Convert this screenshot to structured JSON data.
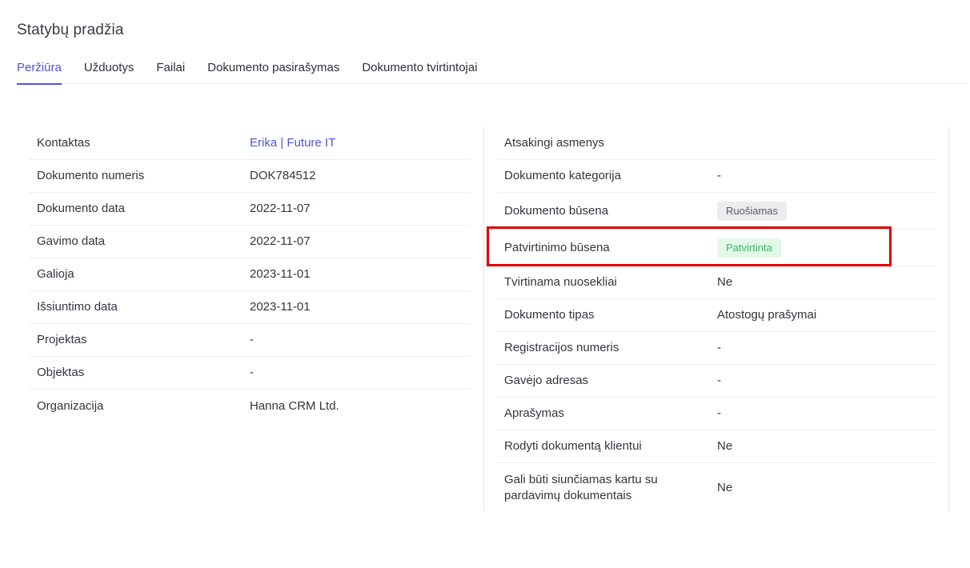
{
  "page": {
    "title": "Statybų pradžia"
  },
  "tabs": [
    {
      "label": "Peržiūra",
      "active": true
    },
    {
      "label": "Užduotys"
    },
    {
      "label": "Failai"
    },
    {
      "label": "Dokumento pasirašymas"
    },
    {
      "label": "Dokumento tvirtintojai"
    }
  ],
  "left": {
    "rows": [
      {
        "label": "Kontaktas",
        "value": "Erika | Future IT"
      },
      {
        "label": "Dokumento numeris",
        "value": "DOK784512"
      },
      {
        "label": "Dokumento data",
        "value": "2022-11-07"
      },
      {
        "label": "Gavimo data",
        "value": "2022-11-07"
      },
      {
        "label": "Galioja",
        "value": "2023-11-01"
      },
      {
        "label": "Išsiuntimo data",
        "value": "2023-11-01"
      },
      {
        "label": "Projektas",
        "value": "-"
      },
      {
        "label": "Objektas",
        "value": "-"
      },
      {
        "label": "Organizacija",
        "value": "Hanna CRM Ltd."
      }
    ]
  },
  "right": {
    "rows": [
      {
        "label": "Atsakingi asmenys",
        "value": ""
      },
      {
        "label": "Dokumento kategorija",
        "value": "-"
      },
      {
        "label": "Dokumento būsena",
        "value": "Ruošiamas"
      },
      {
        "label": "Patvirtinimo būsena",
        "value": "Patvirtinta"
      },
      {
        "label": "Tvirtinama nuosekliai",
        "value": "Ne"
      },
      {
        "label": "Dokumento tipas",
        "value": "Atostogų prašymai"
      },
      {
        "label": "Registracijos numeris",
        "value": "-"
      },
      {
        "label": "Gavėjo adresas",
        "value": "-"
      },
      {
        "label": "Aprašymas",
        "value": "-"
      },
      {
        "label": "Rodyti dokumentą klientui",
        "value": "Ne"
      },
      {
        "label": "Gali būti siunčiamas kartu su pardavimų dokumentais",
        "value": "Ne"
      }
    ]
  },
  "colors": {
    "accent": "#4b55d8",
    "status_grey_bg": "#ececef",
    "status_green_bg": "#e4f8ea",
    "status_green_text": "#3bb865",
    "highlight": "#e00000"
  }
}
